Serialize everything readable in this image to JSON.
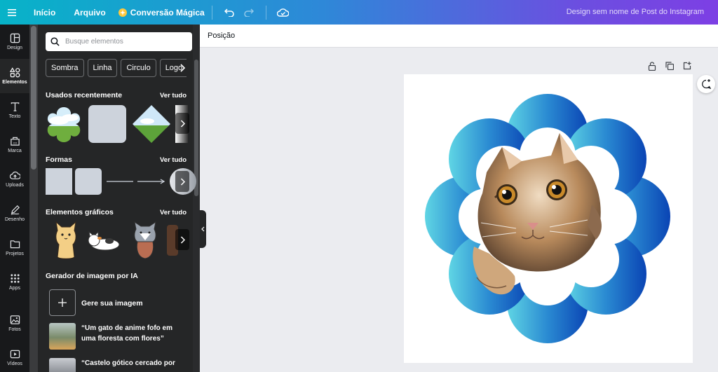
{
  "topbar": {
    "home": "Início",
    "file": "Arquivo",
    "magic": "Conversão Mágica",
    "title": "Design sem nome de Post do Instagram"
  },
  "rail": {
    "items": [
      {
        "label": "Design",
        "icon": "layout-icon"
      },
      {
        "label": "Elementos",
        "icon": "shapes-icon"
      },
      {
        "label": "Texto",
        "icon": "text-icon"
      },
      {
        "label": "Marca",
        "icon": "brand-icon"
      },
      {
        "label": "Uploads",
        "icon": "upload-icon"
      },
      {
        "label": "Desenho",
        "icon": "draw-icon"
      },
      {
        "label": "Projetos",
        "icon": "folder-icon"
      },
      {
        "label": "Apps",
        "icon": "apps-icon"
      },
      {
        "label": "Fotos",
        "icon": "photo-icon"
      },
      {
        "label": "Vídeos",
        "icon": "video-icon"
      }
    ]
  },
  "panel": {
    "search_placeholder": "Busque elementos",
    "chips": [
      "Sombra",
      "Linha",
      "Circulo",
      "Logo"
    ],
    "see_all": "Ver tudo",
    "recent_title": "Usados recentemente",
    "shapes_title": "Formas",
    "graphics_title": "Elementos gráficos",
    "ai_title": "Gerador de imagem por IA",
    "ai_generate": "Gere sua imagem",
    "ai_prompt_1": "“Um gato de anime fofo em uma floresta com flores”",
    "ai_prompt_2": "“Castelo gótico cercado por"
  },
  "canvas": {
    "toolbar_label": "Posição"
  },
  "colors": {
    "accent_start": "#07b3c8",
    "accent_end": "#7d3fe4",
    "panel_bg": "#252627",
    "rail_bg": "#18191b",
    "flower_start": "#5fd5e4",
    "flower_end": "#0a44b4"
  }
}
